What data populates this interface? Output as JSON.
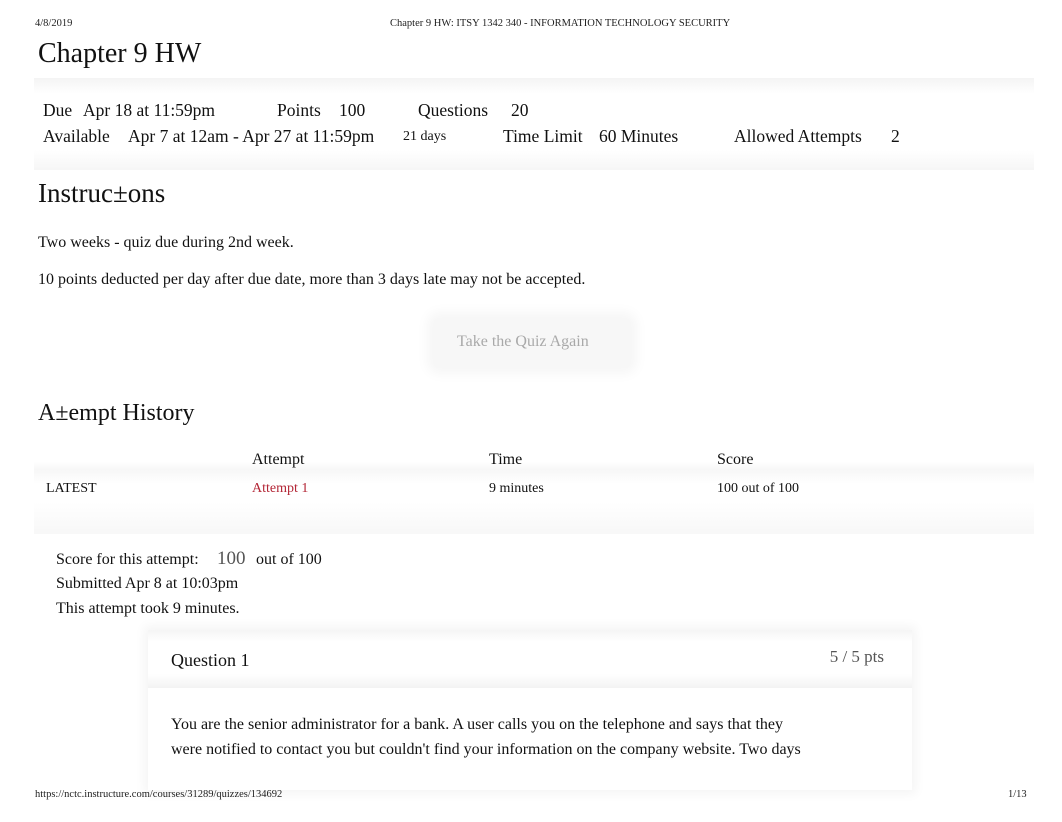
{
  "print_header": {
    "date": "4/8/2019",
    "doc_title": "Chapter 9 HW: ITSY 1342 340 - INFORMATION TECHNOLOGY SECURITY"
  },
  "print_footer": {
    "url": "https://nctc.instructure.com/courses/31289/quizzes/134692",
    "page": "1/13"
  },
  "quiz": {
    "title": "Chapter 9 HW",
    "details": {
      "due_label": "Due",
      "due_value": "Apr 18 at 11:59pm",
      "points_label": "Points",
      "points_value": "100",
      "questions_label": "Questions",
      "questions_value": "20",
      "available_label": "Available",
      "available_value": "Apr 7 at 12am - Apr 27 at 11:59pm",
      "available_duration": "21 days",
      "time_limit_label": "Time Limit",
      "time_limit_value": "60 Minutes",
      "allowed_attempts_label": "Allowed Attempts",
      "allowed_attempts_value": "2"
    },
    "instructions": {
      "heading": "Instruc±ons",
      "lines": [
        "Two weeks - quiz due during 2nd week.",
        "10 points deducted per day after due date, more than 3 days late may not be accepted."
      ]
    },
    "take_quiz_button": "Take the Quiz Again",
    "attempt_history": {
      "heading": "A±empt History",
      "columns": [
        "",
        "Attempt",
        "Time",
        "Score"
      ],
      "rows": [
        {
          "tag": "LATEST",
          "attempt": "Attempt 1",
          "time": "9 minutes",
          "score": "100 out of 100"
        }
      ]
    },
    "summary": {
      "score_label": "Score for this attempt:",
      "score_value": "100",
      "score_suffix": "out of 100",
      "submitted": "Submitted Apr 8 at 10:03pm",
      "duration": "This attempt took 9 minutes."
    },
    "questions": [
      {
        "title": "Question 1",
        "points": "5 / 5 pts",
        "text_lines": [
          "You are the senior administrator for a bank. A user calls you on the telephone and says that they",
          "were notified to contact you but couldn't find your information on the company website. Two days"
        ]
      }
    ]
  },
  "colors": {
    "link": "#b32636",
    "muted": "#a9a9a9"
  }
}
